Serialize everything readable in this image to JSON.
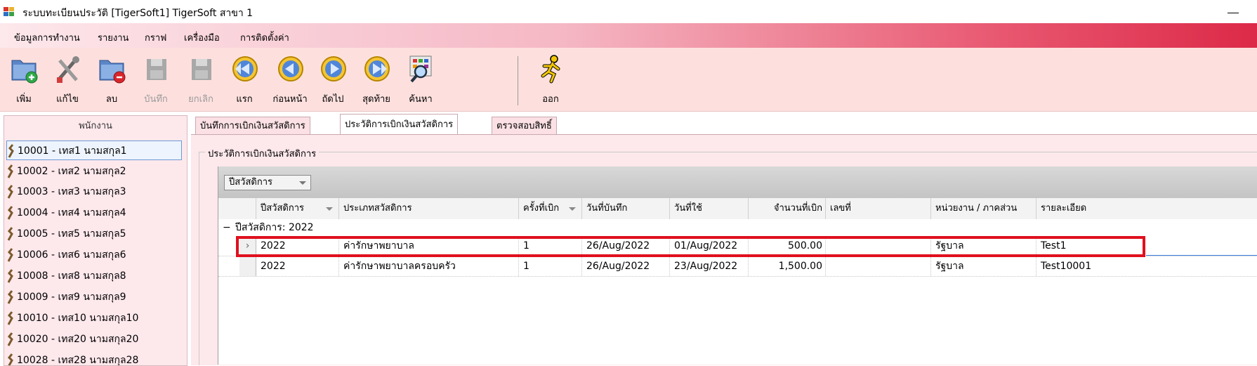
{
  "window": {
    "title": "ระบบทะเบียนประวัติ  [TigerSoft1] TigerSoft สาขา 1"
  },
  "menu": {
    "items": [
      "ข้อมูลการทำงาน",
      "รายงาน",
      "กราฟ",
      "เครื่องมือ",
      "การติดตั้งค่า"
    ]
  },
  "toolbar": {
    "add": "เพิ่ม",
    "edit": "แก้ไข",
    "delete": "ลบ",
    "save": "บันทึก",
    "cancel": "ยกเลิก",
    "first": "แรก",
    "previous": "ก่อนหน้า",
    "next": "ถัดไป",
    "last": "สุดท้าย",
    "search": "ค้นหา",
    "exit": "ออก"
  },
  "employees": {
    "header": "พนักงาน",
    "items": [
      "10001 - เทส1  นามสกุล1",
      "10002 - เทส2  นามสกุล2",
      "10003 - เทส3  นามสกุล3",
      "10004 - เทส4  นามสกุล4",
      "10005 - เทส5  นามสกุล5",
      "10006 - เทส6  นามสกุล6",
      "10008 - เทส8  นามสกุล8",
      "10009 - เทส9  นามสกุล9",
      "10010 - เทส10  นามสกุล10",
      "10020 - เทส20  นามสกุล20",
      "10028 - เทส28  นามสกุล28"
    ],
    "selected_index": 0
  },
  "tabs": [
    {
      "label": "บันทึกการเบิกเงินสวัสดิการ",
      "active": false
    },
    {
      "label": "ประวัติการเบิกเงินสวัสดิการ",
      "active": true
    },
    {
      "label": "ตรวจสอบสิทธิ์",
      "active": false
    }
  ],
  "history": {
    "group_title": "ประวัติการเบิกเงินสวัสดิการ",
    "group_by_chip": "ปีสวัสดิการ",
    "columns": [
      "ปีสวัสดิการ",
      "ประเภทสวัสดิการ",
      "ครั้งที่เบิก",
      "วันที่บันทึก",
      "วันที่ใช้",
      "จำนวนที่เบิก",
      "เลขที่",
      "หน่วยงาน / ภาคส่วน",
      "รายละเอียด"
    ],
    "group_row": {
      "toggle": "−",
      "label": "ปีสวัสดิการ: 2022"
    },
    "rows": [
      {
        "year": "2022",
        "type": "ค่ารักษาพยาบาล",
        "times": "1",
        "record_date": "26/Aug/2022",
        "use_date": "01/Aug/2022",
        "amount": "500.00",
        "number": "",
        "unit": "รัฐบาล",
        "detail": "Test1"
      },
      {
        "year": "2022",
        "type": "ค่ารักษาพยาบาลครอบครัว",
        "times": "1",
        "record_date": "26/Aug/2022",
        "use_date": "23/Aug/2022",
        "amount": "1,500.00",
        "number": "",
        "unit": "รัฐบาล",
        "detail": "Test10001"
      }
    ]
  },
  "colors": {
    "highlight": "#e0101e",
    "accent_menu": "#dc2a48",
    "toolbar_bg": "#fde0de"
  }
}
